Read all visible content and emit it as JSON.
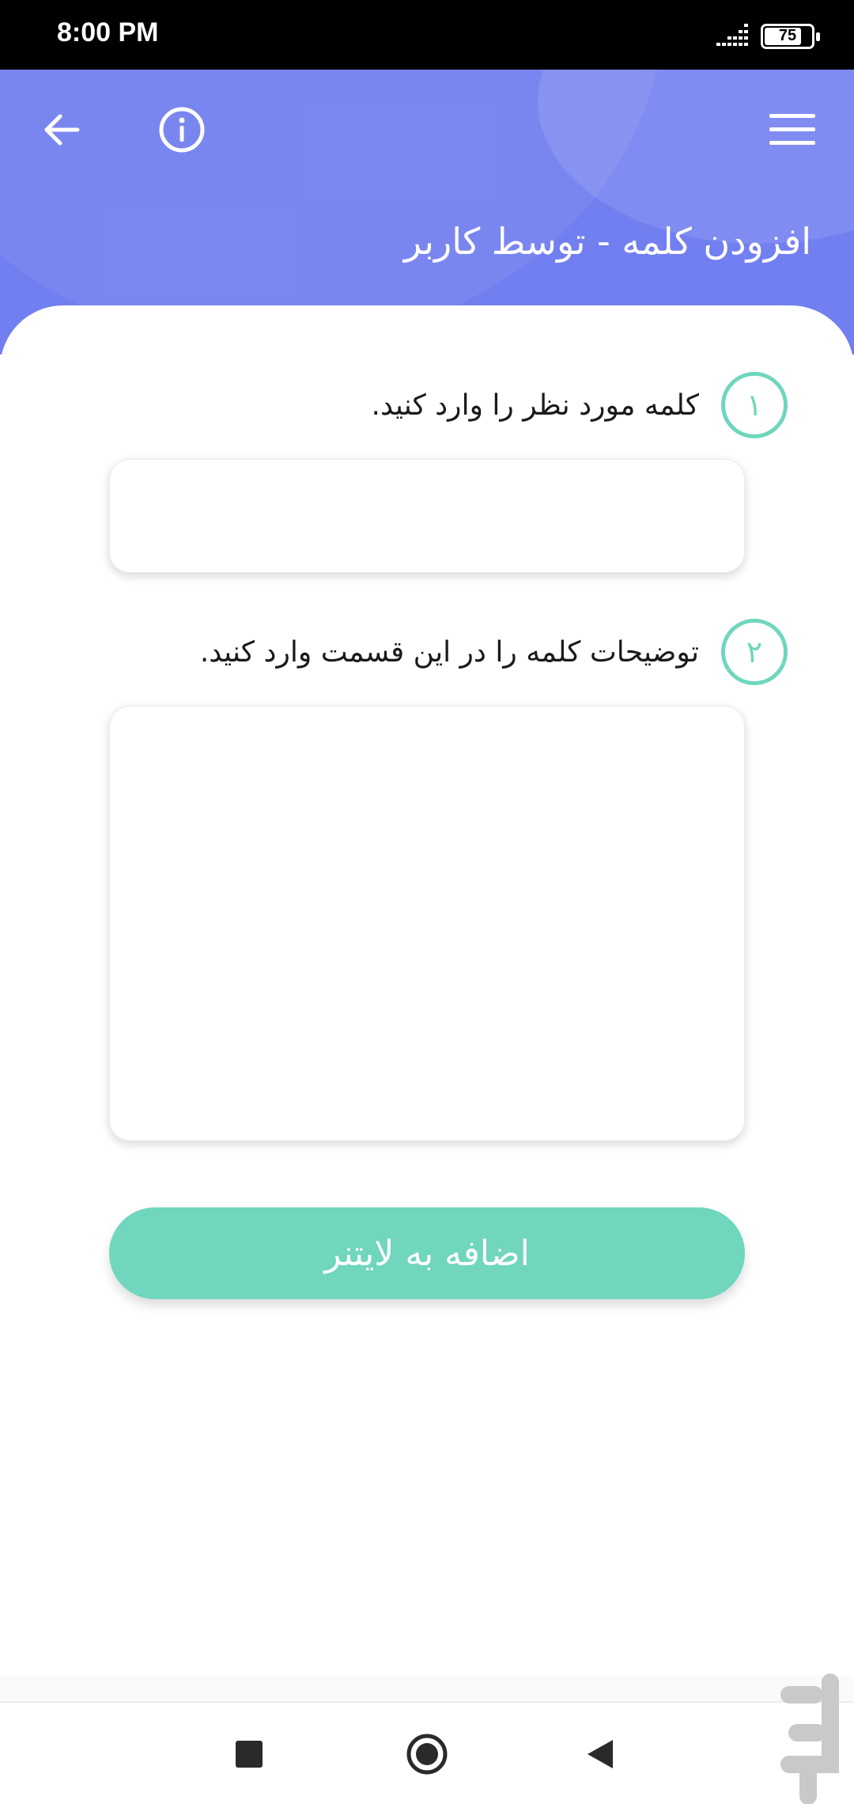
{
  "status_bar": {
    "time": "8:00 PM",
    "battery_level": "75",
    "signal_icon": "signal-icon",
    "battery_icon": "battery-icon"
  },
  "header": {
    "title": "افزودن کلمه - توسط کاربر",
    "back_icon": "arrow-left-icon",
    "info_icon": "info-icon",
    "menu_icon": "hamburger-menu-icon",
    "background_color": "#727ff0"
  },
  "form": {
    "step1": {
      "number": "۱",
      "label": "کلمه مورد نظر را وارد کنید.",
      "value": ""
    },
    "step2": {
      "number": "۲",
      "label": "توضیحات کلمه را در این قسمت وارد کنید.",
      "value": ""
    },
    "submit_label": "اضافه به لایتنر",
    "accent_color": "#70d6be"
  },
  "nav_bar": {
    "recents_icon": "square-icon",
    "home_icon": "circle-home-icon",
    "back_icon": "triangle-back-icon"
  },
  "watermark": {
    "icon": "cafebazaar-logo-icon"
  }
}
